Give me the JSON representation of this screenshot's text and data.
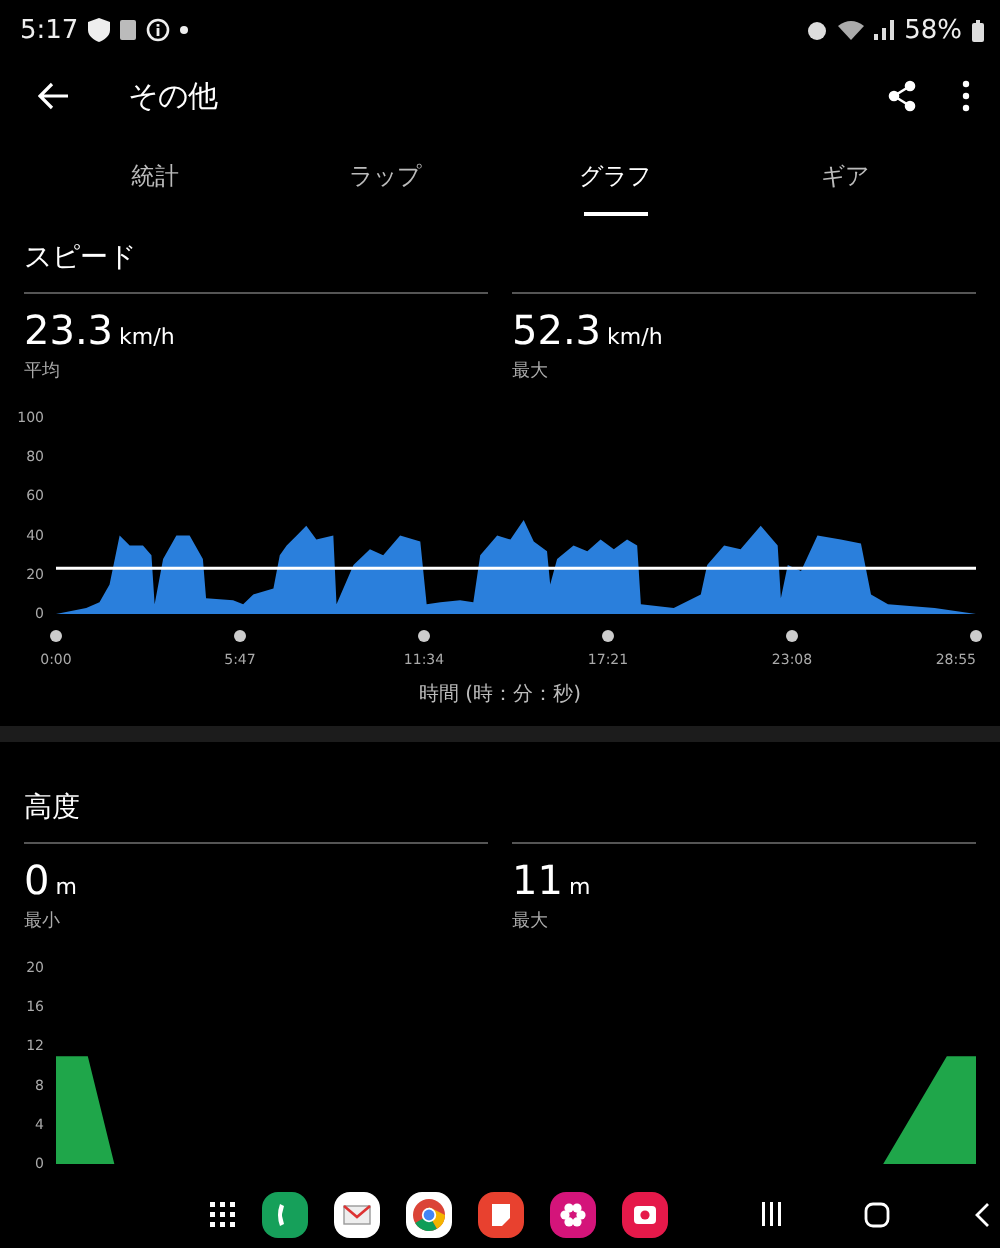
{
  "status_bar": {
    "time": "5:17",
    "battery": "58%"
  },
  "header": {
    "title": "その他"
  },
  "tabs": [
    {
      "label": "統計",
      "selected": false
    },
    {
      "label": "ラップ",
      "selected": false
    },
    {
      "label": "グラフ",
      "selected": true
    },
    {
      "label": "ギア",
      "selected": false
    }
  ],
  "sections": [
    {
      "title": "スピード",
      "stats": [
        {
          "value": "23.3",
          "unit": "km/h",
          "label": "平均"
        },
        {
          "value": "52.3",
          "unit": "km/h",
          "label": "最大"
        }
      ],
      "chart_data": {
        "type": "area",
        "xlabel": "時間 (時：分：秒)",
        "xlim": [
          0,
          1735
        ],
        "ylim": [
          0,
          100
        ],
        "yticks": [
          0,
          20,
          40,
          60,
          80,
          100
        ],
        "xticks": [
          {
            "value": 0,
            "label": "0:00"
          },
          {
            "value": 347,
            "label": "5:47"
          },
          {
            "value": 694,
            "label": "11:34"
          },
          {
            "value": 1041,
            "label": "17:21"
          },
          {
            "value": 1388,
            "label": "23:08"
          },
          {
            "value": 1735,
            "label": "28:55"
          }
        ],
        "x": [
          0,
          57,
          82,
          101,
          120,
          139,
          164,
          180,
          186,
          202,
          227,
          252,
          277,
          283,
          334,
          353,
          372,
          410,
          422,
          435,
          454,
          472,
          491,
          523,
          529,
          561,
          592,
          617,
          649,
          687,
          699,
          725,
          762,
          787,
          800,
          832,
          857,
          882,
          901,
          926,
          932,
          945,
          976,
          1002,
          1027,
          1052,
          1077,
          1096,
          1103,
          1165,
          1216,
          1228,
          1260,
          1291,
          1329,
          1361,
          1367,
          1380,
          1405,
          1436,
          1480,
          1518,
          1537,
          1569,
          1657,
          1735
        ],
        "series": [
          {
            "color": "#2a7fdc",
            "values": [
              0,
              3,
              6,
              15,
              40,
              35,
              35,
              30,
              5,
              28,
              40,
              40,
              28,
              8,
              7,
              5,
              10,
              13,
              30,
              35,
              40,
              45,
              38,
              40,
              5,
              25,
              33,
              30,
              40,
              37,
              5,
              6,
              7,
              6,
              30,
              40,
              38,
              48,
              37,
              32,
              15,
              28,
              35,
              32,
              38,
              33,
              38,
              35,
              5,
              3,
              10,
              25,
              35,
              33,
              45,
              35,
              8,
              25,
              22,
              40,
              38,
              36,
              10,
              5,
              3,
              0
            ]
          }
        ],
        "ref_lines": [
          {
            "axis": "y",
            "value": 23.3
          }
        ]
      }
    },
    {
      "title": "高度",
      "stats": [
        {
          "value": "0",
          "unit": "m",
          "label": "最小"
        },
        {
          "value": "11",
          "unit": "m",
          "label": "最大"
        }
      ],
      "chart_data": {
        "type": "area",
        "xlim": [
          0,
          1735
        ],
        "ylim": [
          0,
          20
        ],
        "yticks": [
          0,
          4,
          8,
          12,
          16,
          20
        ],
        "x": [
          0,
          60,
          110,
          1560,
          1680,
          1735
        ],
        "series": [
          {
            "color": "#1fa64a",
            "values": [
              11,
              11,
              0,
              0,
              11,
              11
            ]
          }
        ]
      }
    }
  ]
}
